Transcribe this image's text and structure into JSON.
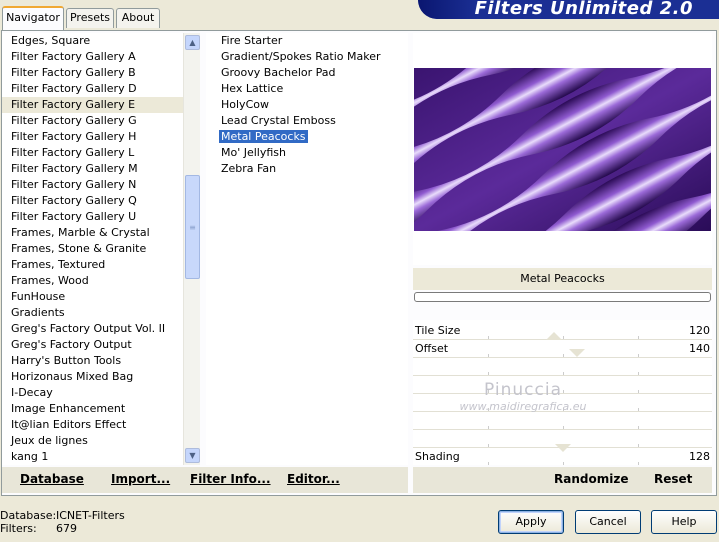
{
  "tabs": [
    {
      "label": "Navigator",
      "active": true
    },
    {
      "label": "Presets",
      "active": false
    },
    {
      "label": "About",
      "active": false
    }
  ],
  "banner_title": "Filters Unlimited 2.0",
  "categories": [
    "Edges, Square",
    "Filter Factory Gallery A",
    "Filter Factory Gallery B",
    "Filter Factory Gallery D",
    "Filter Factory Gallery E",
    "Filter Factory Gallery G",
    "Filter Factory Gallery H",
    "Filter Factory Gallery L",
    "Filter Factory Gallery M",
    "Filter Factory Gallery N",
    "Filter Factory Gallery Q",
    "Filter Factory Gallery U",
    "Frames, Marble & Crystal",
    "Frames, Stone & Granite",
    "Frames, Textured",
    "Frames, Wood",
    "FunHouse",
    "Gradients",
    "Greg's Factory Output Vol. II",
    "Greg's Factory Output",
    "Harry's Button Tools",
    "Horizonaus Mixed Bag",
    "I-Decay",
    "Image Enhancement",
    "It@lian Editors Effect",
    "Jeux de lignes",
    "kang 1"
  ],
  "selected_category": "Filter Factory Gallery E",
  "filters": [
    "Fire Starter",
    "Gradient/Spokes Ratio Maker",
    "Groovy Bachelor Pad",
    "Hex Lattice",
    "HolyCow",
    "Lead Crystal Emboss",
    "Metal Peacocks",
    "Mo' Jellyfish",
    "Zebra Fan"
  ],
  "selected_filter": "Metal Peacocks",
  "left_buttons": {
    "database": "Database",
    "import": "Import...",
    "filter_info": "Filter Info...",
    "editor": "Editor..."
  },
  "preview_filter_name": "Metal Peacocks",
  "params": {
    "tile_size": {
      "label": "Tile Size",
      "value": "120",
      "level": 0.47
    },
    "offset": {
      "label": "Offset",
      "value": "140",
      "level": 0.55
    },
    "shading": {
      "label": "Shading",
      "value": "128",
      "level": 0.5
    }
  },
  "watermark": {
    "line1": "Pinuccia",
    "line2": "www.maidiregrafica.eu"
  },
  "right_buttons": {
    "randomize": "Randomize",
    "reset": "Reset"
  },
  "status": {
    "database_label": "Database:",
    "database_value": "ICNET-Filters",
    "filters_label": "Filters:",
    "filters_value": "679"
  },
  "dialog_buttons": {
    "apply": "Apply",
    "cancel": "Cancel",
    "help": "Help"
  },
  "colors": {
    "accent_blue": "#316ac5",
    "banner_blue": "#1b2f94",
    "preview_purple": "#5b2a9a"
  }
}
